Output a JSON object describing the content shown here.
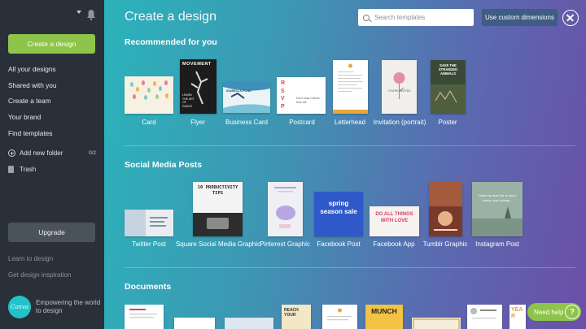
{
  "sidebar": {
    "create_label": "Create a design",
    "nav": [
      "All your designs",
      "Shared with you",
      "Create a team",
      "Your brand",
      "Find templates"
    ],
    "add_folder_label": "Add new folder",
    "folder_count": "0/2",
    "trash_label": "Trash",
    "upgrade_label": "Upgrade",
    "learn_label": "Learn to design",
    "inspiration_label": "Get design inspiration",
    "logo_text": "Canva",
    "tagline": "Empowering the world to design"
  },
  "header": {
    "title": "Create a design",
    "search_placeholder": "Search templates",
    "custom_dimensions_label": "Use custom dimensions"
  },
  "sections": {
    "recommended": {
      "title": "Recommended for you",
      "items": [
        "Card",
        "Flyer",
        "Business Card",
        "Postcard",
        "Letterhead",
        "Invitation (portrait)",
        "Poster"
      ],
      "thumb_text": {
        "flyer_title": "MOVEMENT",
        "flyer_sub": "LEARN THE ART OF DANCE",
        "business_card": "ISABELLA POND",
        "postcard_letters": "RSVP",
        "postcard_side": "Don't miss Cheers from all!",
        "invitation": "YOU'RE INVITED",
        "poster": "SAVE THE STRANDED ANIMALS"
      }
    },
    "social": {
      "title": "Social Media Posts",
      "items": [
        "Twitter Post",
        "Square Social Media Graphic",
        "Pinterest Graphic",
        "Facebook Post",
        "Facebook App",
        "Tumblr Graphic",
        "Instagram Post"
      ],
      "thumb_text": {
        "square": "10 PRODUCTIVITY TIPS",
        "facebook_post": "spring season sale",
        "facebook_app": "DO ALL THINGS WITH LOVE",
        "instagram": "Ouch my love Life is just a lovely, nice holiday..."
      }
    },
    "documents": {
      "title": "Documents",
      "thumb_text": {
        "reach": "REACH YOUR",
        "munch": "MUNCH",
        "year": "YEAR"
      }
    }
  },
  "help": {
    "label": "Need help",
    "icon": "?"
  },
  "colors": {
    "accent_green": "#8ec44a",
    "sidebar_bg": "#293039",
    "custom_btn": "#3e5c84"
  }
}
